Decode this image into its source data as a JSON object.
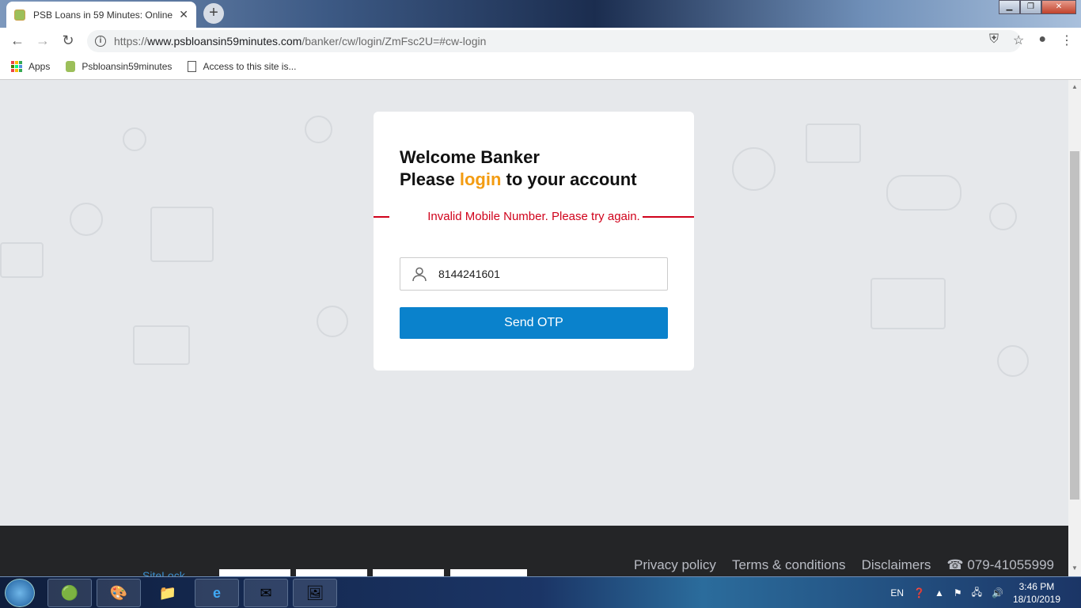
{
  "browser": {
    "tab_title": "PSB Loans in 59 Minutes: Online",
    "url_scheme": "https://",
    "url_host": "www.psbloansin59minutes.com",
    "url_path": "/banker/cw/login/ZmFsc2U=#cw-login",
    "bookmarks": [
      {
        "label": "Apps",
        "icon": "apps-grid-icon"
      },
      {
        "label": "Psbloansin59minutes",
        "icon": "site-favicon"
      },
      {
        "label": "Access to this site is...",
        "icon": "page-icon"
      }
    ]
  },
  "login": {
    "line1": "Welcome Banker",
    "line2_pre": "Please ",
    "line2_accent": "login",
    "line2_post": " to your account",
    "error": "Invalid Mobile Number. Please try again.",
    "mobile_value": "8144241601",
    "button": "Send OTP"
  },
  "footer": {
    "sitelock": "SiteLock",
    "links": [
      "Privacy policy",
      "Terms & conditions",
      "Disclaimers"
    ],
    "phone": "079-41055999"
  },
  "taskbar": {
    "lang": "EN",
    "time": "3:46 PM",
    "date": "18/10/2019"
  },
  "colors": {
    "accent": "#f39c12",
    "error": "#d0021b",
    "button": "#0a82cc"
  }
}
